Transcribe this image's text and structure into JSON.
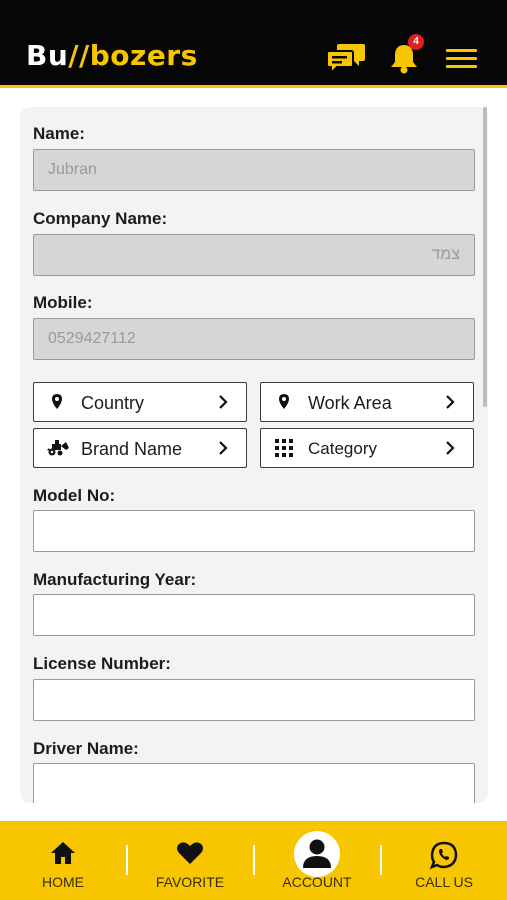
{
  "header": {
    "logo_prefix": "Bu",
    "logo_mark": "//",
    "logo_suffix": "ozers",
    "logo_b": "b",
    "chat_icon": "chat-bubbles-icon",
    "bell_icon": "bell-icon",
    "notification_count": "4",
    "menu_icon": "hamburger-menu-icon"
  },
  "form": {
    "name_label": "Name:",
    "name_value": "Jubran",
    "company_label": "Company Name:",
    "company_value": "צמד",
    "mobile_label": "Mobile:",
    "mobile_value": "0529427112",
    "country_label": "Country",
    "work_area_label": "Work Area",
    "brand_label": "Brand Name",
    "category_label": "Category",
    "model_label": "Model No:",
    "model_value": "",
    "year_label": "Manufacturing Year:",
    "year_value": "",
    "license_label": "License Number:",
    "license_value": "",
    "driver_label": "Driver Name:",
    "driver_value": ""
  },
  "bottom_nav": {
    "items": [
      {
        "label": "HOME",
        "icon": "home-icon"
      },
      {
        "label": "FAVORITE",
        "icon": "heart-icon"
      },
      {
        "label": "ACCOUNT",
        "icon": "user-icon"
      },
      {
        "label": "CALL US",
        "icon": "whatsapp-icon"
      }
    ]
  },
  "colors": {
    "accent": "#f7c600",
    "header_bg": "#060606",
    "badge": "#e02020",
    "card_bg": "#f3f3f3"
  }
}
